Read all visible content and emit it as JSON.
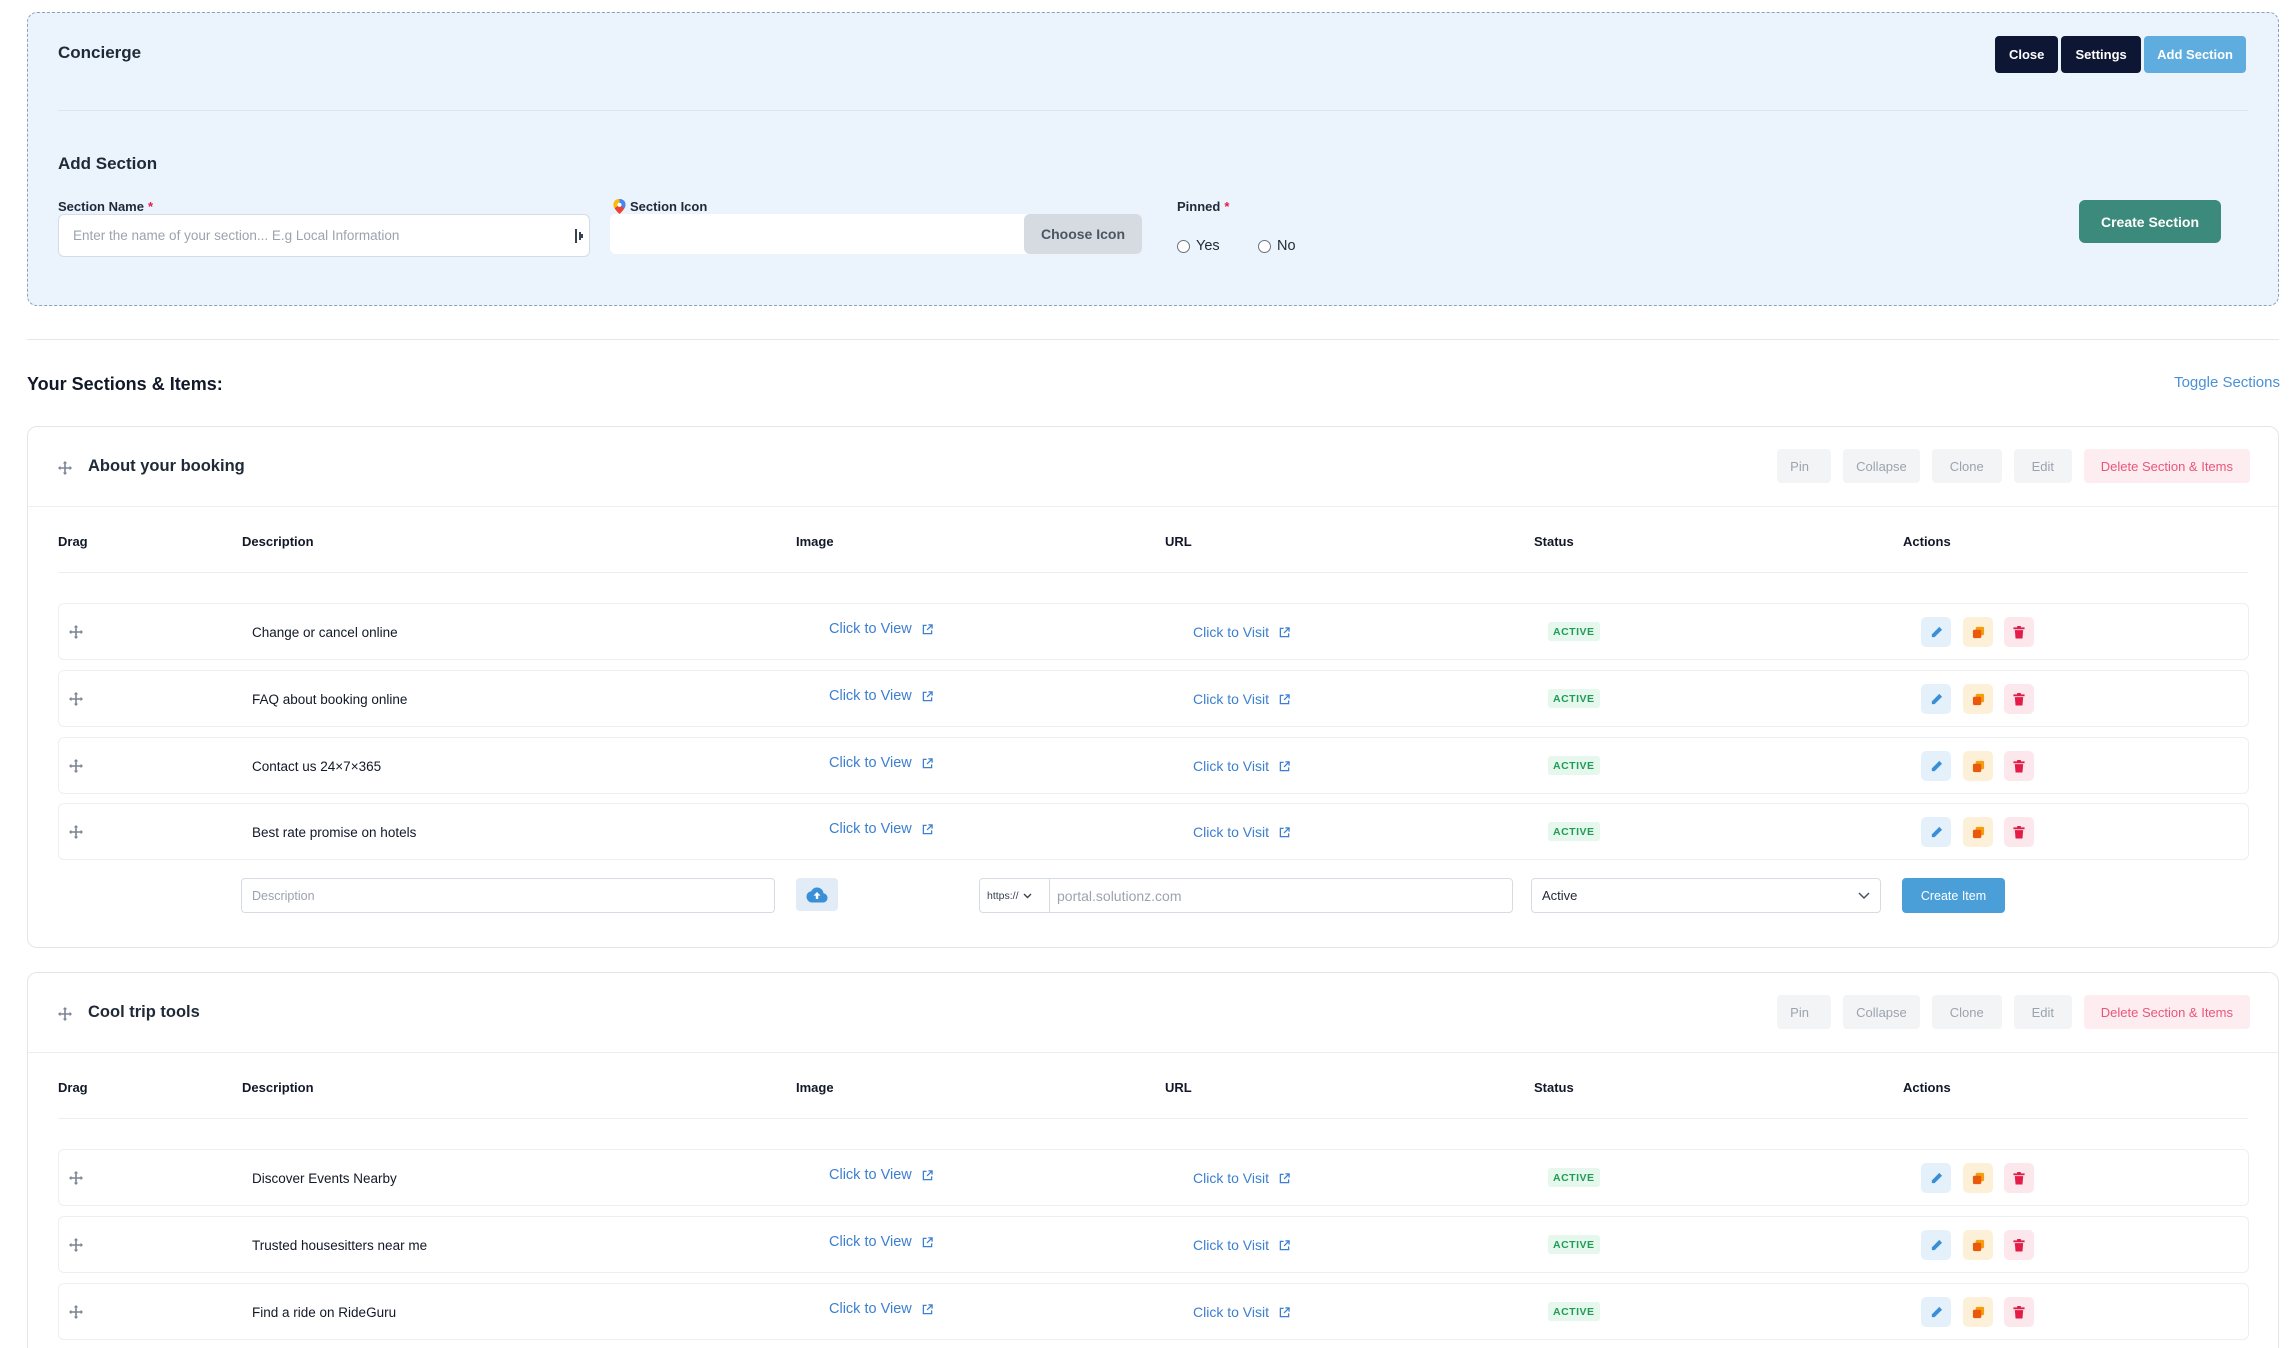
{
  "top": {
    "title": "Concierge",
    "close_label": "Close",
    "settings_label": "Settings",
    "add_section_label": "Add Section"
  },
  "add_section": {
    "title": "Add Section",
    "name_label": "Section Name",
    "name_placeholder": "Enter the name of your section... E.g Local Information",
    "icon_label": "Section Icon",
    "choose_icon_label": "Choose Icon",
    "pinned_label": "Pinned",
    "required_mark": "*",
    "yes_label": "Yes",
    "no_label": "No",
    "create_label": "Create Section"
  },
  "list": {
    "title": "Your Sections & Items:",
    "toggle_label": "Toggle Sections"
  },
  "section_buttons": {
    "pin": "Pin",
    "collapse": "Collapse",
    "clone": "Clone",
    "edit": "Edit",
    "delete": "Delete Section & Items"
  },
  "columns": [
    "Drag",
    "Description",
    "Image",
    "URL",
    "Status",
    "Actions"
  ],
  "item_links": {
    "view": "Click to View",
    "visit": "Click to Visit",
    "status": "ACTIVE"
  },
  "sections": [
    {
      "title": "About your booking",
      "items": [
        "Change or cancel online",
        "FAQ about booking online",
        "Contact us 24×7×365",
        "Best rate promise on hotels"
      ]
    },
    {
      "title": "Cool trip tools",
      "items": [
        "Discover Events Nearby",
        "Trusted housesitters near me",
        "Find a ride on RideGuru"
      ]
    }
  ],
  "new_item": {
    "description_placeholder": "Description",
    "protocol": "https://",
    "url_placeholder": "portal.solutionz.com",
    "status_value": "Active",
    "create_label": "Create Item"
  },
  "colors": {
    "panel_bg": "#ebf4fc",
    "dark_button": "#0d1632",
    "accent_blue": "#5fadde",
    "create_section": "#3c8a7b",
    "link": "#3b7fd0",
    "active_badge": "#1f9d55",
    "danger": "#e8577a"
  },
  "icons": {
    "drag": "move-arrows-icon",
    "section_icon": "map-pin-icon",
    "external": "external-link-icon",
    "upload": "cloud-upload-icon",
    "edit": "pencil-icon",
    "copy": "copy-icon",
    "delete": "trash-icon"
  }
}
